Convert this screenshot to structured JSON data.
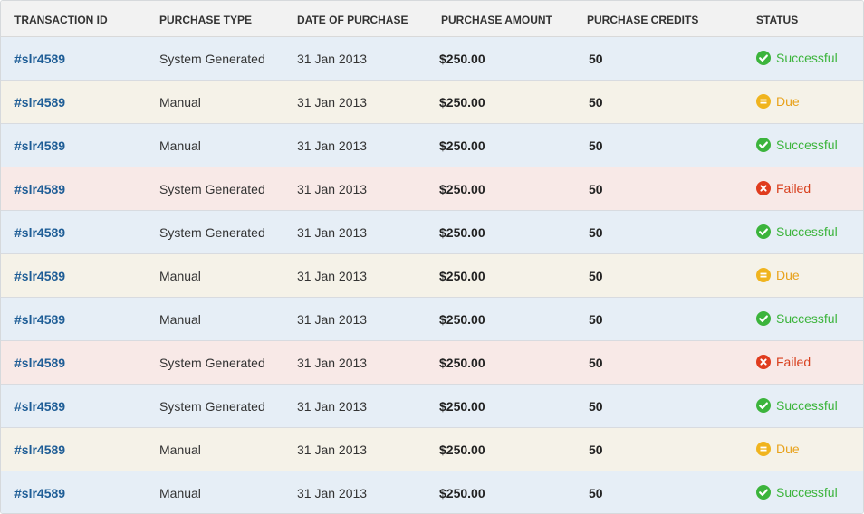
{
  "table": {
    "columns": [
      "TRANSACTION ID",
      "PURCHASE TYPE",
      "DATE OF PURCHASE",
      "PURCHASE AMOUNT",
      "PURCHASE CREDITS",
      "STATUS"
    ],
    "rows": [
      {
        "id": "#slr4589",
        "type": "System Generated",
        "date": "31 Jan 2013",
        "amount": "$250.00",
        "credits": "50",
        "status": "Successful",
        "status_key": "successful"
      },
      {
        "id": "#slr4589",
        "type": "Manual",
        "date": "31 Jan 2013",
        "amount": "$250.00",
        "credits": "50",
        "status": "Due",
        "status_key": "due"
      },
      {
        "id": "#slr4589",
        "type": "Manual",
        "date": "31 Jan 2013",
        "amount": "$250.00",
        "credits": "50",
        "status": "Successful",
        "status_key": "successful"
      },
      {
        "id": "#slr4589",
        "type": "System Generated",
        "date": "31 Jan 2013",
        "amount": "$250.00",
        "credits": "50",
        "status": "Failed",
        "status_key": "failed"
      },
      {
        "id": "#slr4589",
        "type": "System Generated",
        "date": "31 Jan 2013",
        "amount": "$250.00",
        "credits": "50",
        "status": "Successful",
        "status_key": "successful"
      },
      {
        "id": "#slr4589",
        "type": "Manual",
        "date": "31 Jan 2013",
        "amount": "$250.00",
        "credits": "50",
        "status": "Due",
        "status_key": "due"
      },
      {
        "id": "#slr4589",
        "type": "Manual",
        "date": "31 Jan 2013",
        "amount": "$250.00",
        "credits": "50",
        "status": "Successful",
        "status_key": "successful"
      },
      {
        "id": "#slr4589",
        "type": "System Generated",
        "date": "31 Jan 2013",
        "amount": "$250.00",
        "credits": "50",
        "status": "Failed",
        "status_key": "failed"
      },
      {
        "id": "#slr4589",
        "type": "System Generated",
        "date": "31 Jan 2013",
        "amount": "$250.00",
        "credits": "50",
        "status": "Successful",
        "status_key": "successful"
      },
      {
        "id": "#slr4589",
        "type": "Manual",
        "date": "31 Jan 2013",
        "amount": "$250.00",
        "credits": "50",
        "status": "Due",
        "status_key": "due"
      },
      {
        "id": "#slr4589",
        "type": "Manual",
        "date": "31 Jan 2013",
        "amount": "$250.00",
        "credits": "50",
        "status": "Successful",
        "status_key": "successful"
      }
    ]
  },
  "status_styles": {
    "successful": {
      "icon": "check-circle-icon",
      "color": "#3cb43c",
      "row_bg": "#e6eef6"
    },
    "due": {
      "icon": "pending-circle-icon",
      "color": "#f0b41e",
      "row_bg": "#f5f2e8"
    },
    "failed": {
      "icon": "x-circle-icon",
      "color": "#e03c1e",
      "row_bg": "#f8e9e7"
    }
  },
  "colors": {
    "link": "#1e5d96",
    "header_bg": "#f2f2f2",
    "text": "#333333"
  }
}
